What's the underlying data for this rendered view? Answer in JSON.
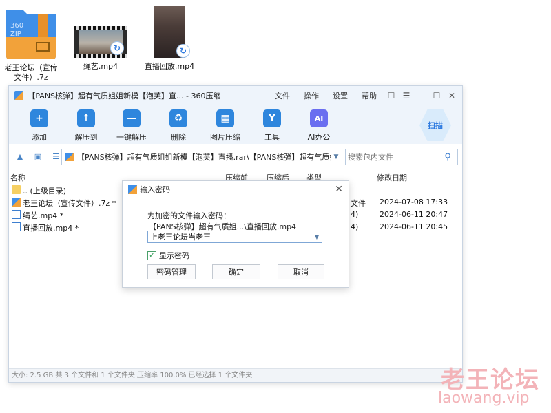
{
  "desktop": {
    "icons": [
      {
        "label": "老王论坛（宣传文件）.7z",
        "icon": "zip-archive-icon",
        "zip_text_1": "360",
        "zip_text_2": "ZIP"
      },
      {
        "label": "绳艺.mp4",
        "icon": "video-file-icon"
      },
      {
        "label": "直播回放.mp4",
        "icon": "video-file-icon"
      }
    ]
  },
  "window": {
    "title": "【PANS核弹】超有气质姐姐新模【泡芙】直... - 360压缩",
    "menu": [
      "文件",
      "操作",
      "设置",
      "帮助"
    ],
    "controls": [
      "☐",
      "☰",
      "—",
      "☐",
      "✕"
    ],
    "toolbar": [
      {
        "label": "添加",
        "icon": "add-icon",
        "glyph": "+"
      },
      {
        "label": "解压到",
        "icon": "extract-to-icon",
        "glyph": "↑"
      },
      {
        "label": "一键解压",
        "icon": "one-click-extract-icon",
        "glyph": "—"
      },
      {
        "label": "删除",
        "icon": "delete-icon",
        "glyph": "♻"
      },
      {
        "label": "图片压缩",
        "icon": "image-compress-icon",
        "glyph": "▦"
      },
      {
        "label": "工具",
        "icon": "tools-icon",
        "glyph": "Y"
      },
      {
        "label": "AI办公",
        "icon": "ai-office-icon",
        "glyph": "AI"
      }
    ],
    "scan_label": "扫描",
    "path": "【PANS核弹】超有气质姐姐新模【泡芙】直播.rar\\【PANS核弹】超有气质姐姐新",
    "search_placeholder": "搜索包内文件",
    "columns": {
      "name": "名称",
      "before": "压缩前",
      "after": "压缩后",
      "type": "类型",
      "date": "修改日期"
    },
    "rows": [
      {
        "name": ".. (上级目录)",
        "icon": "folder-icon",
        "type": "",
        "date": ""
      },
      {
        "name": "老王论坛（宣传文件）.7z *",
        "icon": "zip-file-icon",
        "type": "文件",
        "date": "2024-07-08 17:33"
      },
      {
        "name": "绳艺.mp4 *",
        "icon": "video-file-icon",
        "type": "4)",
        "date": "2024-06-11 20:47"
      },
      {
        "name": "直播回放.mp4 *",
        "icon": "video-file-icon",
        "type": "4)",
        "date": "2024-06-11 20:45"
      }
    ],
    "status": "大小: 2.5 GB 共 3 个文件和 1 个文件夹 压缩率 100.0% 已经选择 1 个文件夹"
  },
  "dialog": {
    "title": "输入密码",
    "prompt": "为加密的文件输入密码：",
    "file": "【PANS核弹】超有气质姐...\\直播回放.mp4",
    "password": "上老王论坛当老王",
    "show_password_label": "显示密码",
    "show_password_checked": true,
    "buttons": {
      "manage": "密码管理",
      "ok": "确定",
      "cancel": "取消"
    }
  },
  "watermark": {
    "line1": "老王论坛",
    "line2": "laowang.vip"
  }
}
